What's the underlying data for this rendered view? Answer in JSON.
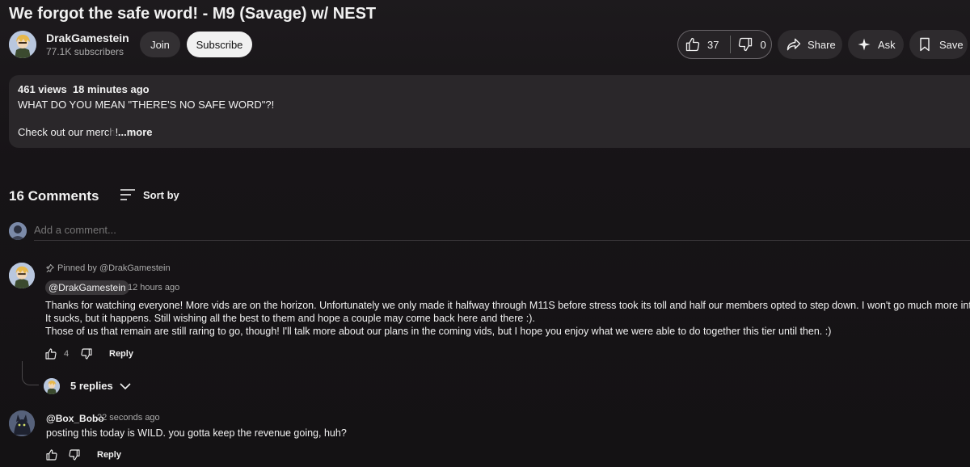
{
  "video": {
    "title": "We forgot the safe word! - M9 (Savage) w/ NEST",
    "channel_name": "DrakGamestein",
    "subscribers": "77.1K subscribers",
    "join_label": "Join",
    "subscribe_label": "Subscribe",
    "like_count": "37",
    "dislike_count": "0",
    "share_label": "Share",
    "ask_label": "Ask",
    "save_label": "Save"
  },
  "description": {
    "meta": "461 views  18 minutes ago",
    "line1": "WHAT DO YOU MEAN \"THERE'S NO SAFE WORD\"?!",
    "line2": "Check out our merch!",
    "more_label": "...more"
  },
  "comments_header": {
    "count_label": "16 Comments",
    "sort_label": "Sort by",
    "add_placeholder": "Add a comment..."
  },
  "comments": [
    {
      "pinned_label": "Pinned by @DrakGamestein",
      "author": "@DrakGamestein",
      "timestamp": "12 hours ago",
      "lines": [
        "Thanks for watching everyone! More vids are on the horizon. Unfortunately we only made it halfway through M11S before stress took its toll and half our members opted to step down. I won't go much more into that",
        "It sucks, but it happens. Still wishing all the best to them and hope a couple may come back here and there :).",
        "Those of us that remain are still raring to go, though! I'll talk more about our plans in the coming vids, but I hope you enjoy what we were able to do together this tier until then. :)"
      ],
      "likes": "4",
      "reply_label": "Reply",
      "replies_label": "5 replies"
    },
    {
      "author": "@Box_Bobo",
      "timestamp": "22 seconds ago",
      "lines": [
        "posting this today is WILD. you gotta keep the revenue going, huh?"
      ],
      "likes": "",
      "reply_label": "Reply"
    }
  ],
  "colors": {
    "background": "#141214",
    "surface": "#2a272a",
    "text_primary": "#f1f1f1",
    "text_secondary": "#aaaaaa"
  }
}
